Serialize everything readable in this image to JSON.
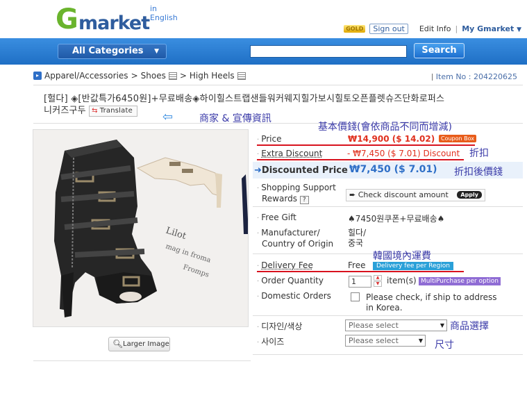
{
  "header": {
    "logo_text": "Gmarket",
    "logo_sub": "in English",
    "gold_badge": "GOLD",
    "sign_out": "Sign out",
    "edit_info": "Edit Info",
    "separator": "|",
    "my_gmarket": "My Gmarket",
    "all_categories": "All Categories",
    "search_button": "Search",
    "search_value": ""
  },
  "breadcrumb": {
    "level1": "Apparel/Accessories",
    "level2": "Shoes",
    "level3": "High Heels",
    "sep": ">",
    "item_no_label": "Item No :",
    "item_no": "204220625"
  },
  "product": {
    "title_line1": "[헐다] ◈[반값특가6450원]+무료배송◈하이힐스트랩샌들워커웨지힐가보시힐토오픈플렛슈즈단화로퍼스",
    "title_line2": "니커즈구두",
    "translate_label": "Translate"
  },
  "annotations": {
    "seller_info": "商家 & 宣傳資訊",
    "base_price": "基本價錢(會依商品不同而增減)",
    "discount": "折扣",
    "after_discount": "折扣後價錢",
    "domestic_shipping": "韓國境內運費",
    "option_select": "商品選擇",
    "size": "尺寸"
  },
  "info": {
    "price_label": "Price",
    "price_value": "₩14,900 ($ 14.02)",
    "coupon_box": "Coupon Box",
    "extra_discount_label": "Extra Discount",
    "extra_discount_value": "- ₩7,450 ($ 7.01) Discount",
    "discounted_price_label": "Discounted Price",
    "discounted_price_value": "₩7,450 ($ 7.01)",
    "support_label_1": "Shopping Support",
    "support_label_2": "Rewards",
    "help_glyph": "?",
    "check_discount": "Check discount amount",
    "apply": "Apply",
    "free_gift_label": "Free Gift",
    "free_gift_value": "♠7450원쿠폰+무료배송♠",
    "manufacturer_label_1": "Manufacturer/",
    "manufacturer_label_2": "Country of Origin",
    "manufacturer_value_1": "힐다/",
    "manufacturer_value_2": "중국",
    "delivery_label": "Delivery Fee",
    "delivery_value": "Free",
    "delivery_badge": "Delivery fee per Region",
    "qty_label": "Order Quantity",
    "qty_value": "1",
    "qty_unit": "item(s)",
    "multi_badge": "MultiPurchase per option",
    "domestic_label": "Domestic Orders",
    "domestic_text_1": "Please check, if ship to address",
    "domestic_text_2": "in Korea.",
    "design_label": "디자인/색상",
    "design_select": "Please select",
    "size_label": "사이즈",
    "size_select": "Please select"
  },
  "image": {
    "larger_button": "Larger Image"
  },
  "colors": {
    "nav_blue": "#1f6fc5",
    "logo_green": "#6ab42d",
    "price_red": "#e0301e",
    "annotation_blue": "#3a3aa8"
  }
}
